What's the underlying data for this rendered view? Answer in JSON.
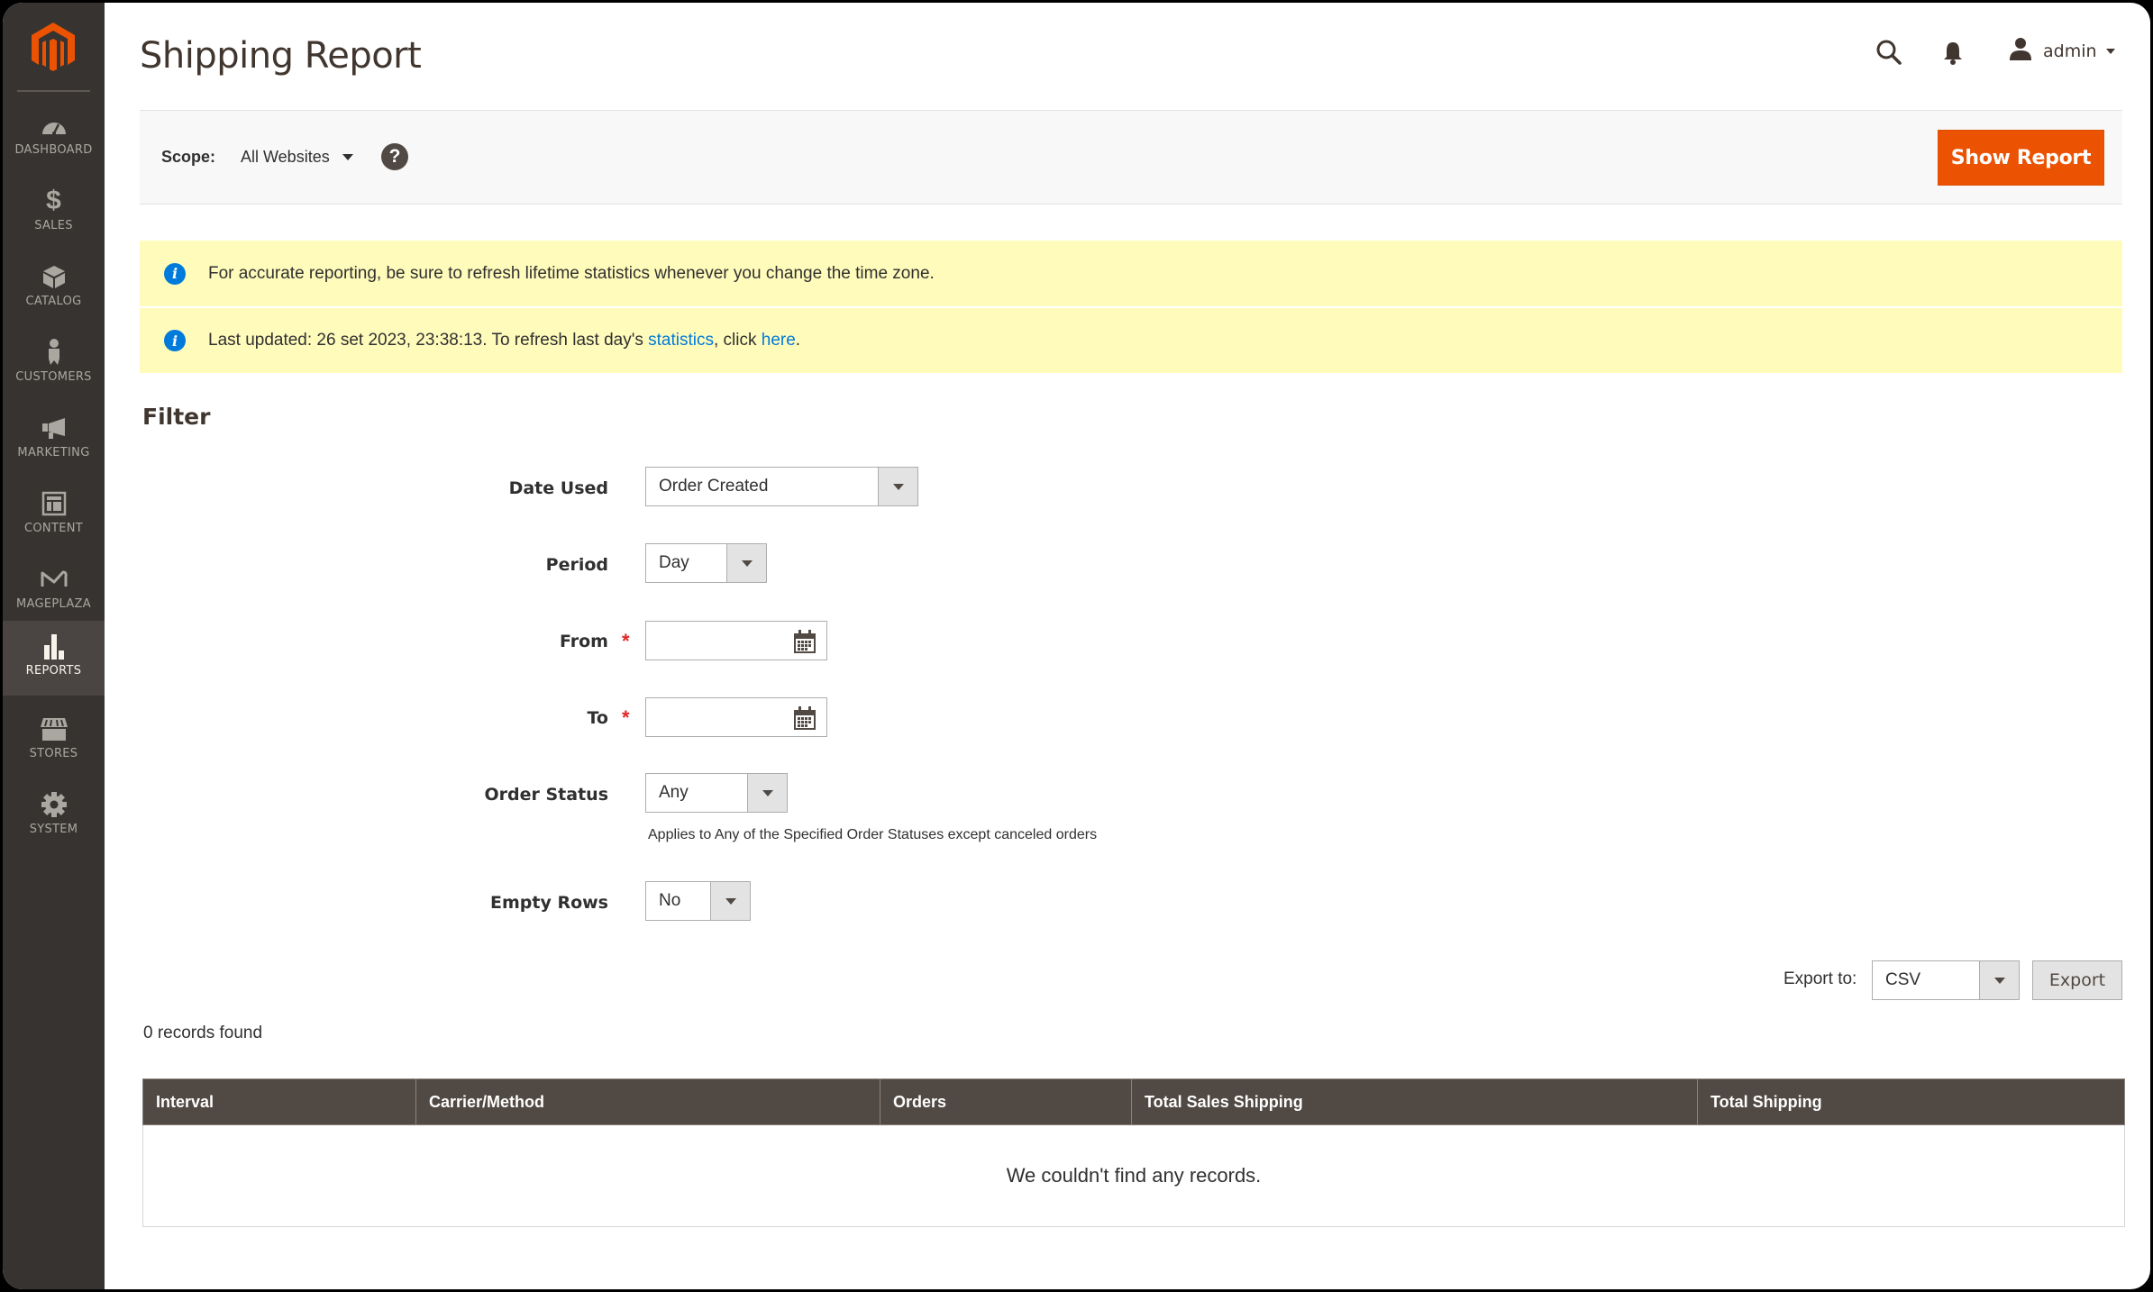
{
  "sidebar": {
    "logo": "magento-logo",
    "items": [
      {
        "label": "Dashboard",
        "icon": "dashboard-icon",
        "active": false
      },
      {
        "label": "Sales",
        "icon": "dollar-icon",
        "active": false
      },
      {
        "label": "Catalog",
        "icon": "box-icon",
        "active": false
      },
      {
        "label": "Customers",
        "icon": "person-icon",
        "active": false
      },
      {
        "label": "Marketing",
        "icon": "megaphone-icon",
        "active": false
      },
      {
        "label": "Content",
        "icon": "layout-icon",
        "active": false
      },
      {
        "label": "Mageplaza",
        "icon": "mageplaza-icon",
        "active": false
      },
      {
        "label": "Reports",
        "icon": "bar-chart-icon",
        "active": true
      },
      {
        "label": "Stores",
        "icon": "storefront-icon",
        "active": false
      },
      {
        "label": "System",
        "icon": "gear-icon",
        "active": false
      }
    ]
  },
  "header": {
    "title": "Shipping Report",
    "user": "admin"
  },
  "scope": {
    "label": "Scope:",
    "value": "All Websites",
    "help": "?",
    "show_report": "Show Report"
  },
  "notices": {
    "first": "For accurate reporting, be sure to refresh lifetime statistics whenever you change the time zone.",
    "second_prefix": "Last updated: 26 set 2023, 23:38:13. To refresh last day's ",
    "second_link1": "statistics",
    "second_mid": ", click ",
    "second_link2": "here",
    "second_suffix": "."
  },
  "filter": {
    "title": "Filter",
    "date_used": {
      "label": "Date Used",
      "value": "Order Created"
    },
    "period": {
      "label": "Period",
      "value": "Day"
    },
    "from": {
      "label": "From",
      "value": "",
      "required": "*"
    },
    "to": {
      "label": "To",
      "value": "",
      "required": "*"
    },
    "order_status": {
      "label": "Order Status",
      "value": "Any",
      "note": "Applies to Any of the Specified Order Statuses except canceled orders"
    },
    "empty_rows": {
      "label": "Empty Rows",
      "value": "No"
    }
  },
  "export": {
    "label": "Export to:",
    "format": "CSV",
    "button": "Export"
  },
  "grid": {
    "records": "0 records found",
    "columns": [
      "Interval",
      "Carrier/Method",
      "Orders",
      "Total Sales Shipping",
      "Total Shipping"
    ],
    "empty": "We couldn't find any records."
  },
  "colors": {
    "accent": "#eb5202",
    "sidebar": "#373330",
    "table_header": "#514943",
    "notice_bg": "#fffbbb",
    "link": "#007bdb"
  }
}
